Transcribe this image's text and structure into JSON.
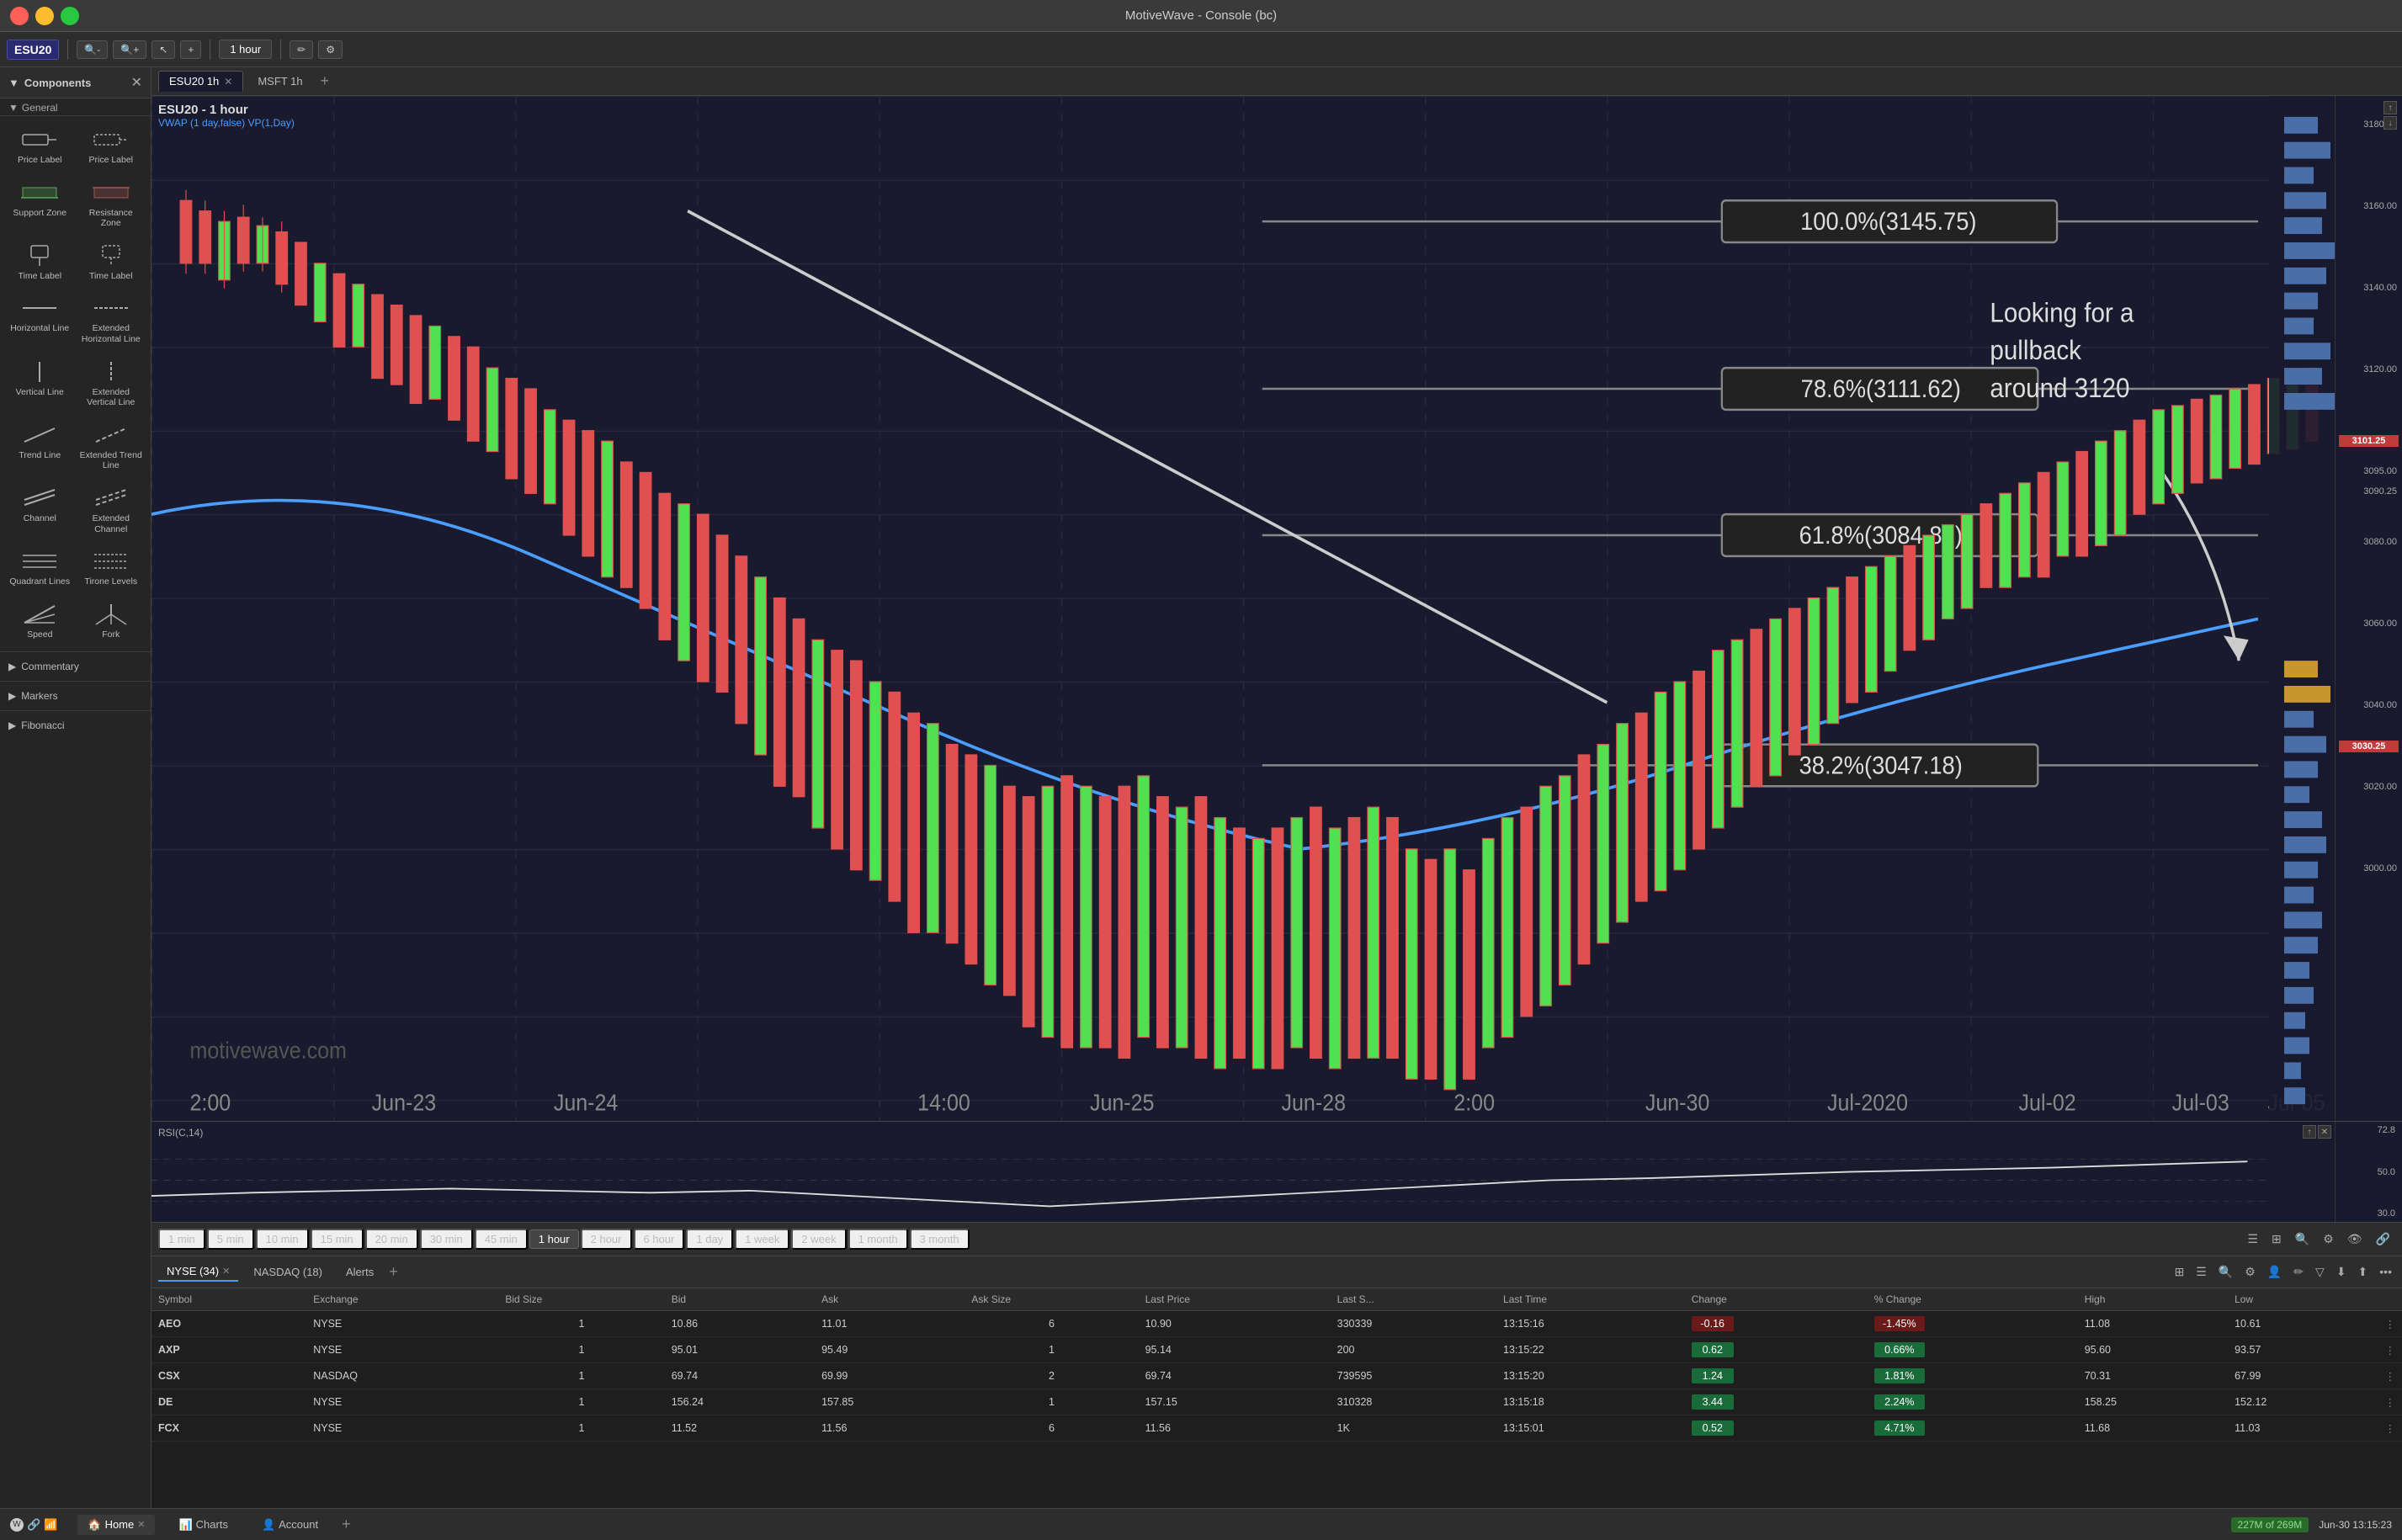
{
  "app": {
    "title": "MotiveWave - Console (bc)"
  },
  "toolbar": {
    "symbol": "ESU20",
    "timeframe": "1 hour",
    "timeframe_options": [
      "1 min",
      "5 min",
      "10 min",
      "15 min",
      "20 min",
      "30 min",
      "45 min",
      "1 hour",
      "2 hour",
      "6 hour",
      "1 day",
      "1 week",
      "2 week",
      "1 month",
      "3 month"
    ]
  },
  "chart_tabs": [
    {
      "label": "ESU20 1h",
      "active": true
    },
    {
      "label": "MSFT 1h",
      "active": false
    }
  ],
  "chart": {
    "title": "ESU20 - 1 hour",
    "subtitle": "VWAP (1 day,false)  VP(1,Day)",
    "annotation": "Looking for a\npullback\naround 3120",
    "fib_levels": [
      {
        "label": "100.0%(3145.75)",
        "pct": 0.0
      },
      {
        "label": "78.6%(3111.62)",
        "pct": 22.0
      },
      {
        "label": "61.8%(3084.82)",
        "pct": 39.0
      },
      {
        "label": "38.2%(3047.18)",
        "pct": 62.0
      }
    ],
    "price_levels": [
      {
        "price": "3180.00",
        "top_pct": 2
      },
      {
        "price": "3160.00",
        "top_pct": 10
      },
      {
        "price": "3140.00",
        "top_pct": 18
      },
      {
        "price": "3120.00",
        "top_pct": 26
      },
      {
        "price": "3101.25",
        "top_pct": 33,
        "highlight": "#e05050"
      },
      {
        "price": "3095.00",
        "top_pct": 36
      },
      {
        "price": "3090.25",
        "top_pct": 38
      },
      {
        "price": "3080.00",
        "top_pct": 43
      },
      {
        "price": "3060.00",
        "top_pct": 51
      },
      {
        "price": "3040.00",
        "top_pct": 59
      },
      {
        "price": "3030.25",
        "top_pct": 63,
        "highlight": "#e05050"
      },
      {
        "price": "3020.00",
        "top_pct": 67
      },
      {
        "price": "3000.00",
        "top_pct": 75
      }
    ],
    "x_labels": [
      "2:00",
      "Jun-23",
      "Jun-24",
      "14:00",
      "Jun-25",
      "Jun-28",
      "2:00",
      "Jun-30",
      "Jul-2020",
      "Jul-02",
      "Jul-03",
      "Jul-05"
    ],
    "watermark": "motivewave.com"
  },
  "rsi": {
    "label": "RSI(C,14)",
    "values": [
      "72.8",
      "50.0",
      "30.0"
    ]
  },
  "time_buttons": [
    {
      "label": "1 min",
      "active": false
    },
    {
      "label": "5 min",
      "active": false
    },
    {
      "label": "10 min",
      "active": false
    },
    {
      "label": "15 min",
      "active": false
    },
    {
      "label": "20 min",
      "active": false
    },
    {
      "label": "30 min",
      "active": false
    },
    {
      "label": "45 min",
      "active": false
    },
    {
      "label": "1 hour",
      "active": true
    },
    {
      "label": "2 hour",
      "active": false
    },
    {
      "label": "6 hour",
      "active": false
    },
    {
      "label": "1 day",
      "active": false
    },
    {
      "label": "1 week",
      "active": false
    },
    {
      "label": "2 week",
      "active": false
    },
    {
      "label": "1 month",
      "active": false
    },
    {
      "label": "3 month",
      "active": false
    }
  ],
  "sidebar": {
    "title": "Components",
    "section_general": "General",
    "items": [
      {
        "id": "price-label-1",
        "label": "Price Label",
        "icon": "price-label"
      },
      {
        "id": "price-label-2",
        "label": "Price Label",
        "icon": "price-label-alt"
      },
      {
        "id": "support-zone",
        "label": "Support Zone",
        "icon": "support-zone"
      },
      {
        "id": "resistance-zone",
        "label": "Resistance Zone",
        "icon": "resistance-zone"
      },
      {
        "id": "time-label-1",
        "label": "Time Label",
        "icon": "time-label"
      },
      {
        "id": "time-label-2",
        "label": "Time Label",
        "icon": "time-label-alt"
      },
      {
        "id": "horizontal-line",
        "label": "Horizontal Line",
        "icon": "h-line"
      },
      {
        "id": "extended-horizontal-line",
        "label": "Extended Horizontal Line",
        "icon": "ext-h-line"
      },
      {
        "id": "vertical-line",
        "label": "Vertical Line",
        "icon": "v-line"
      },
      {
        "id": "extended-vertical-line",
        "label": "Extended Vertical Line",
        "icon": "ext-v-line"
      },
      {
        "id": "trend-line",
        "label": "Trend Line",
        "icon": "trend-line"
      },
      {
        "id": "extended-trend-line",
        "label": "Extended Trend Line",
        "icon": "ext-trend-line"
      },
      {
        "id": "channel",
        "label": "Channel",
        "icon": "channel"
      },
      {
        "id": "extended-channel",
        "label": "Extended Channel",
        "icon": "ext-channel"
      },
      {
        "id": "quadrant-lines",
        "label": "Quadrant Lines",
        "icon": "quadrant"
      },
      {
        "id": "tirone-levels",
        "label": "Tirone Levels",
        "icon": "tirone"
      },
      {
        "id": "speed",
        "label": "Speed",
        "icon": "speed"
      },
      {
        "id": "fork",
        "label": "Fork",
        "icon": "fork"
      }
    ],
    "sections": [
      {
        "id": "commentary",
        "label": "Commentary"
      },
      {
        "id": "markers",
        "label": "Markers"
      },
      {
        "id": "fibonacci",
        "label": "Fibonacci"
      }
    ]
  },
  "watchlist": {
    "tabs": [
      {
        "label": "NYSE (34)",
        "active": true
      },
      {
        "label": "NASDAQ (18)",
        "active": false
      },
      {
        "label": "Alerts",
        "active": false
      }
    ],
    "columns": [
      "Symbol",
      "Exchange",
      "Bid Size",
      "Bid",
      "Ask",
      "Ask Size",
      "Last Price",
      "Last S...",
      "Last Time",
      "Change",
      "% Change",
      "High",
      "Low"
    ],
    "rows": [
      {
        "symbol": "AEO",
        "exchange": "NYSE",
        "bid_size": "1",
        "bid": "10.86",
        "ask": "11.01",
        "ask_size": "6",
        "last_price": "10.90",
        "last_s": "330339",
        "last_time": "13:15:16",
        "change": "-0.16",
        "change_pct": "-1.45%",
        "high": "11.08",
        "low": "10.61",
        "change_type": "neg"
      },
      {
        "symbol": "AXP",
        "exchange": "NYSE",
        "bid_size": "1",
        "bid": "95.01",
        "ask": "95.49",
        "ask_size": "1",
        "last_price": "95.14",
        "last_s": "200",
        "last_time": "13:15:22",
        "change": "0.62",
        "change_pct": "0.66%",
        "high": "95.60",
        "low": "93.57",
        "change_type": "pos"
      },
      {
        "symbol": "CSX",
        "exchange": "NASDAQ",
        "bid_size": "1",
        "bid": "69.74",
        "ask": "69.99",
        "ask_size": "2",
        "last_price": "69.74",
        "last_s": "739595",
        "last_time": "13:15:20",
        "change": "1.24",
        "change_pct": "1.81%",
        "high": "70.31",
        "low": "67.99",
        "change_type": "pos"
      },
      {
        "symbol": "DE",
        "exchange": "NYSE",
        "bid_size": "1",
        "bid": "156.24",
        "ask": "157.85",
        "ask_size": "1",
        "last_price": "157.15",
        "last_s": "310328",
        "last_time": "13:15:18",
        "change": "3.44",
        "change_pct": "2.24%",
        "high": "158.25",
        "low": "152.12",
        "change_type": "pos"
      },
      {
        "symbol": "FCX",
        "exchange": "NYSE",
        "bid_size": "1",
        "bid": "11.52",
        "ask": "11.56",
        "ask_size": "6",
        "last_price": "11.56",
        "last_s": "1K",
        "last_time": "13:15:01",
        "change": "0.52",
        "change_pct": "4.71%",
        "high": "11.68",
        "low": "11.03",
        "change_type": "pos"
      }
    ]
  },
  "bottom_bar": {
    "tabs": [
      {
        "label": "Home",
        "icon": "home-icon",
        "active": true,
        "closeable": true
      },
      {
        "label": "Charts",
        "icon": "charts-icon",
        "active": false,
        "closeable": false
      },
      {
        "label": "Account",
        "icon": "account-icon",
        "active": false,
        "closeable": false
      }
    ],
    "memory": "227M of 269M",
    "datetime": "Jun-30 13:15:23"
  }
}
